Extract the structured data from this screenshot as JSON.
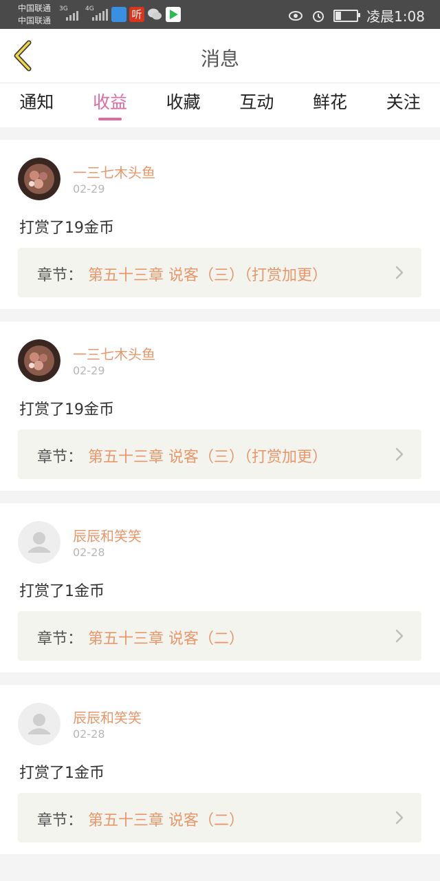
{
  "status_bar": {
    "carrier_1": "中国联通",
    "carrier_2": "中国联通",
    "net_1": "3G",
    "net_2": "4G",
    "listen_app": "听",
    "time": "凌晨1:08",
    "icons": [
      "eye-icon",
      "alarm-icon",
      "battery-icon",
      "wechat-icon",
      "video-app-icon",
      "message-app-icon"
    ]
  },
  "header": {
    "title": "消息",
    "back_icon": "back-chevron-icon"
  },
  "tabs": [
    {
      "label": "通知"
    },
    {
      "label": "收益",
      "active": true
    },
    {
      "label": "收藏"
    },
    {
      "label": "互动"
    },
    {
      "label": "鲜花"
    },
    {
      "label": "关注"
    }
  ],
  "items": [
    {
      "user": "一三七木头鱼",
      "date": "02-29",
      "message": "打赏了19金币",
      "chapter_label": "章节：",
      "chapter": "第五十三章 说客（三）（打赏加更）",
      "avatar": "photo"
    },
    {
      "user": "一三七木头鱼",
      "date": "02-29",
      "message": "打赏了19金币",
      "chapter_label": "章节：",
      "chapter": "第五十三章 说客（三）（打赏加更）",
      "avatar": "photo"
    },
    {
      "user": "辰辰和笑笑",
      "date": "02-28",
      "message": "打赏了1金币",
      "chapter_label": "章节：",
      "chapter": "第五十三章 说客（二）",
      "avatar": "default"
    },
    {
      "user": "辰辰和笑笑",
      "date": "02-28",
      "message": "打赏了1金币",
      "chapter_label": "章节：",
      "chapter": "第五十三章 说客（二）",
      "avatar": "default"
    }
  ],
  "colors": {
    "accent": "#e06aa2",
    "username": "#e8976a",
    "chapter_bg": "#f4f4ef"
  }
}
